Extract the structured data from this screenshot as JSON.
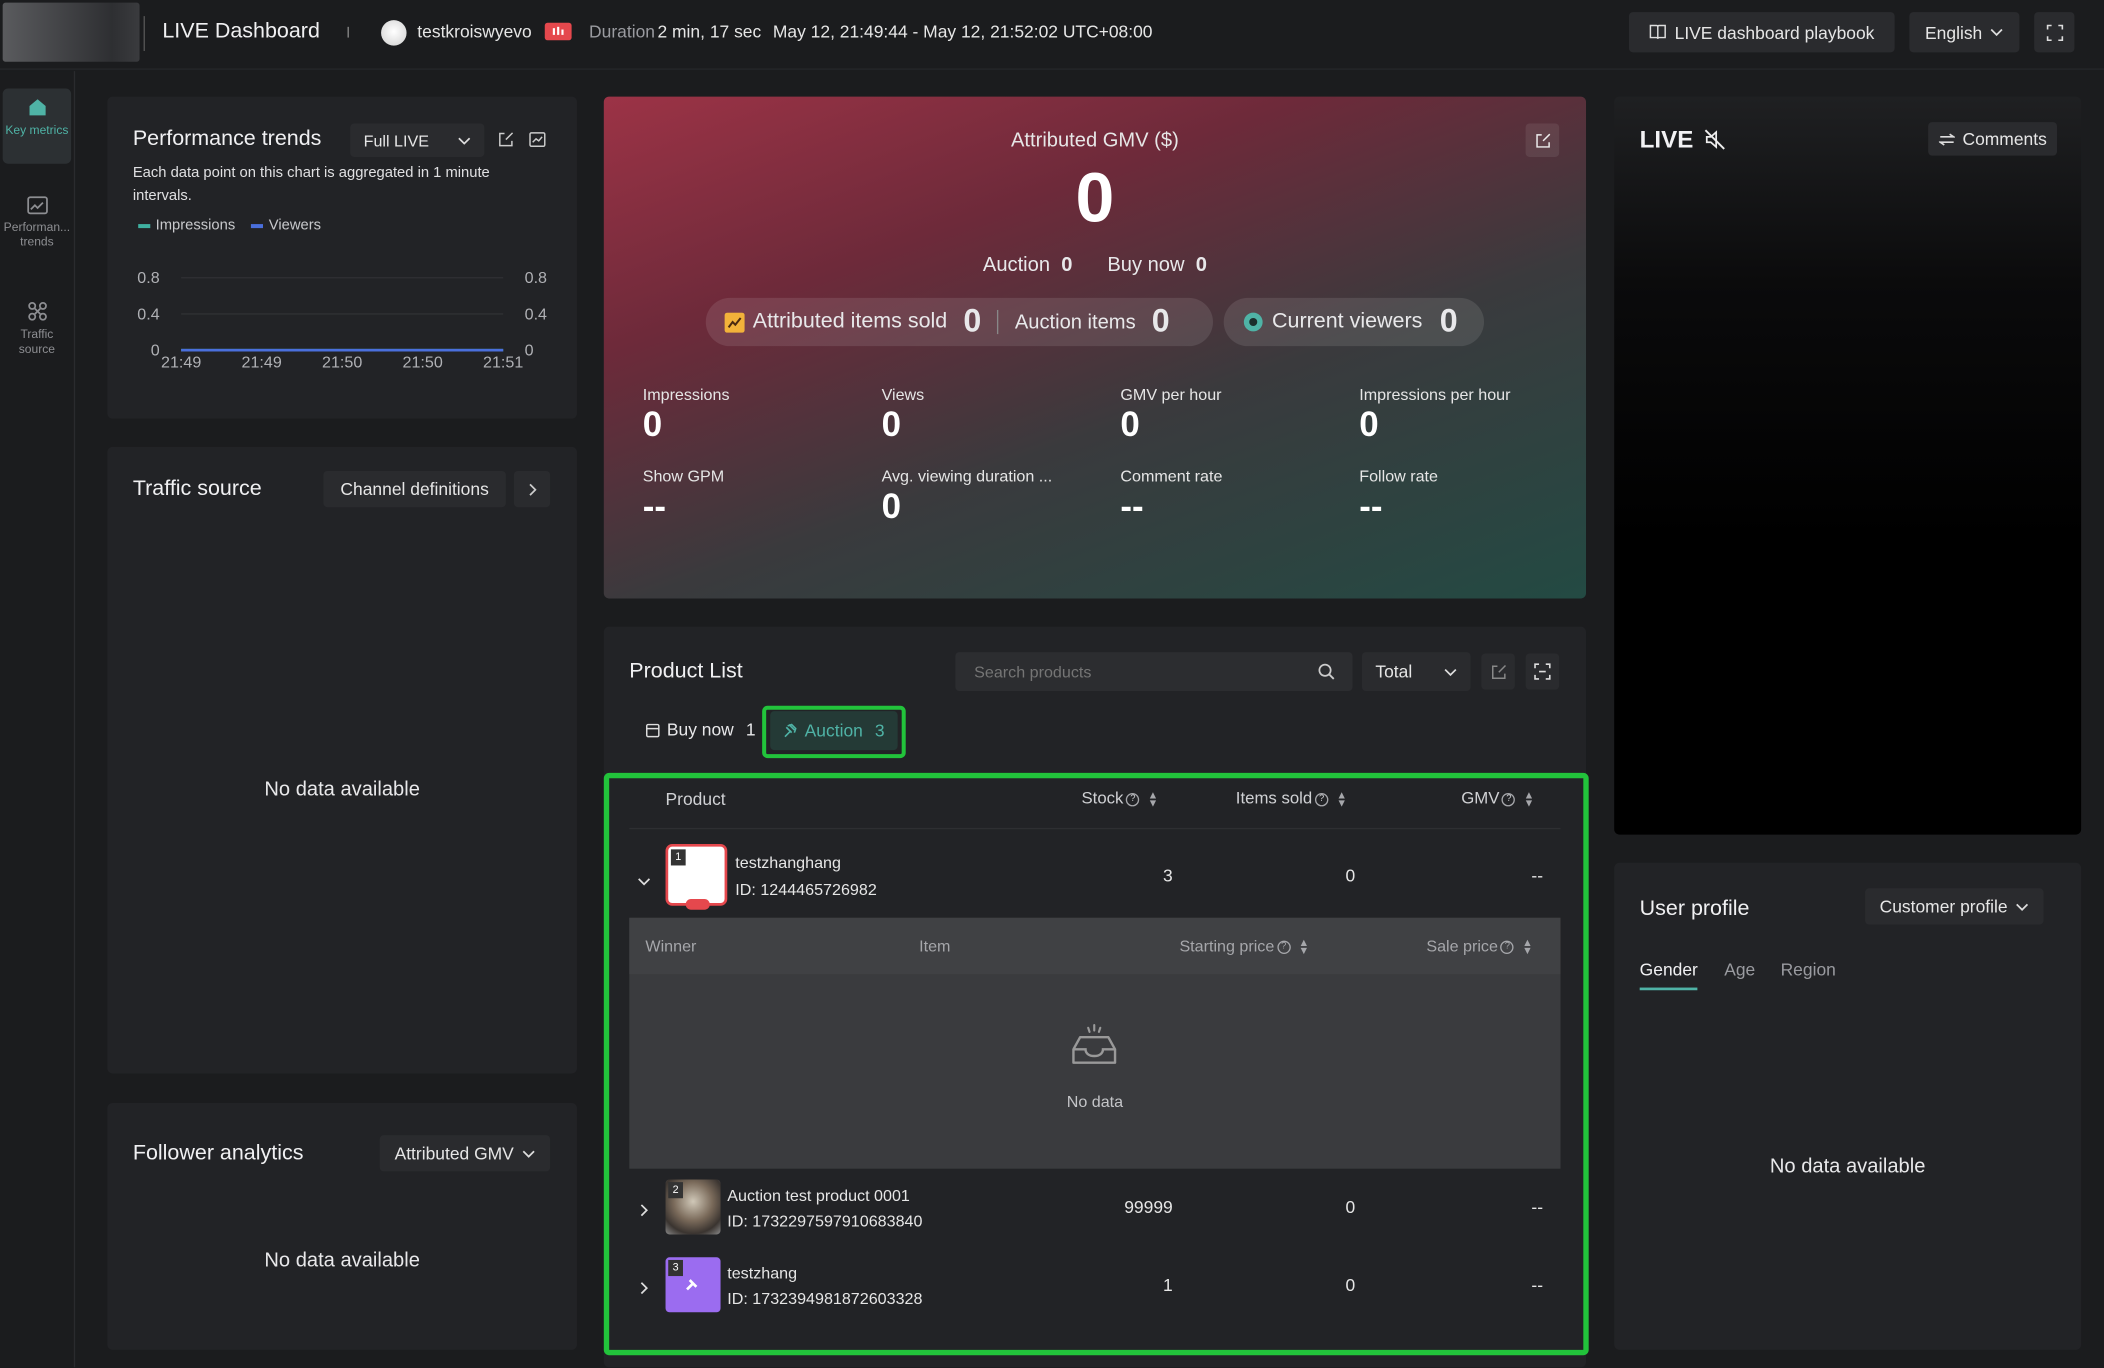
{
  "topbar": {
    "title": "LIVE Dashboard",
    "username": "testkroiswyevo",
    "duration_label": "Duration",
    "duration_value": "2 min, 17 sec",
    "time_range": "May 12, 21:49:44 - May 12, 21:52:02 UTC+08:00",
    "playbook_label": "LIVE dashboard playbook",
    "language": "English"
  },
  "sidebar": {
    "items": [
      {
        "label": "Key metrics",
        "icon": "home-icon",
        "active": true
      },
      {
        "label": "Performan... trends",
        "icon": "chart-icon",
        "active": false
      },
      {
        "label": "Traffic source",
        "icon": "traffic-icon",
        "active": false
      }
    ]
  },
  "performance": {
    "title": "Performance trends",
    "select_value": "Full LIVE",
    "description": "Each data point on this chart is aggregated in 1 minute intervals.",
    "legend": [
      {
        "name": "Impressions",
        "color": "#3fb0a0"
      },
      {
        "name": "Viewers",
        "color": "#4a6fdc"
      }
    ]
  },
  "chart_data": {
    "type": "line",
    "x": [
      "21:49",
      "21:49",
      "21:50",
      "21:50",
      "21:51"
    ],
    "series": [
      {
        "name": "Impressions",
        "values": [
          0,
          0,
          0,
          0,
          0
        ]
      },
      {
        "name": "Viewers",
        "values": [
          0,
          0,
          0,
          0,
          0
        ]
      }
    ],
    "y_ticks": [
      "0.8",
      "0.4",
      "0"
    ],
    "y_ticks_right": [
      "0.8",
      "0.4",
      "0"
    ],
    "ylim": [
      0,
      1
    ],
    "grid": true,
    "legend_position": "top-left"
  },
  "traffic": {
    "title": "Traffic source",
    "channel_btn": "Channel definitions",
    "no_data": "No data available"
  },
  "follower": {
    "title": "Follower analytics",
    "select_value": "Attributed GMV",
    "no_data": "No data available"
  },
  "gmv": {
    "title": "Attributed GMV ($)",
    "value": "0",
    "auction_label": "Auction",
    "auction_value": "0",
    "buynow_label": "Buy now",
    "buynow_value": "0",
    "items_sold_label": "Attributed items sold",
    "items_sold_value": "0",
    "auction_items_label": "Auction items",
    "auction_items_value": "0",
    "viewers_label": "Current viewers",
    "viewers_value": "0",
    "metrics": [
      {
        "label": "Impressions",
        "value": "0"
      },
      {
        "label": "Views",
        "value": "0"
      },
      {
        "label": "GMV per hour",
        "value": "0"
      },
      {
        "label": "Impressions per hour",
        "value": "0"
      },
      {
        "label": "Show GPM",
        "value": "--"
      },
      {
        "label": "Avg. viewing duration ...",
        "value": "0"
      },
      {
        "label": "Comment rate",
        "value": "--"
      },
      {
        "label": "Follow rate",
        "value": "--"
      }
    ]
  },
  "products": {
    "title": "Product List",
    "search_placeholder": "Search products",
    "total_select": "Total",
    "tab_buynow_label": "Buy now",
    "tab_buynow_count": "1",
    "tab_auction_label": "Auction",
    "tab_auction_count": "3",
    "columns": [
      "Product",
      "Stock",
      "Items sold",
      "GMV"
    ],
    "rows": [
      {
        "rank": "1",
        "name": "testzhanghang",
        "id": "ID: 1244465726982",
        "stock": "3",
        "sold": "0",
        "gmv": "--"
      },
      {
        "rank": "2",
        "name": "Auction test product 0001",
        "id": "ID: 1732297597910683840",
        "stock": "99999",
        "sold": "0",
        "gmv": "--"
      },
      {
        "rank": "3",
        "name": "testzhang",
        "id": "ID: 1732394981872603328",
        "stock": "1",
        "sold": "0",
        "gmv": "--"
      }
    ],
    "sub_columns": [
      "Winner",
      "Item",
      "Starting price",
      "Sale price"
    ],
    "sub_no_data": "No data"
  },
  "live": {
    "title": "LIVE",
    "comments_label": "Comments"
  },
  "user_profile": {
    "title": "User profile",
    "select_value": "Customer profile",
    "tabs": [
      "Gender",
      "Age",
      "Region"
    ],
    "no_data": "No data available"
  },
  "colors": {
    "accent": "#4fb3a6",
    "highlight": "#22c33b",
    "live_red": "#e5484d"
  }
}
